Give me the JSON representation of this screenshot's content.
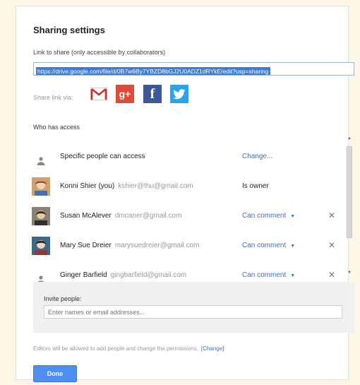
{
  "dialog": {
    "title": "Sharing settings",
    "link_label": "Link to share (only accessible by collaborators)",
    "link_url": "https://drive.google.com/file/d/0B7w6By7YBZD8bGJ2U0ADZ1dRYkE/edit?usp=sharing",
    "share_via_label": "Share link via:",
    "share_icons": [
      "gmail-icon",
      "google-plus-icon",
      "facebook-icon",
      "twitter-icon"
    ],
    "gplus_glyph": "g+",
    "fb_glyph": "f",
    "who_has_access_label": "Who has access"
  },
  "access": {
    "specific": {
      "label": "Specific people can access",
      "action": "Change..."
    },
    "people": [
      {
        "name": "Konni Shier (you)",
        "email": "kshier@thu@gmail.com",
        "permission": "Is owner"
      },
      {
        "name": "Susan McAlever",
        "email": "dmcaner@gmail.com",
        "permission": "Can comment",
        "caret": "▼",
        "remove": "✕"
      },
      {
        "name": "Mary Sue Dreier",
        "email": "marysuedreier@gmail.com",
        "permission": "Can comment",
        "caret": "▼",
        "remove": "✕"
      },
      {
        "name": "Ginger Barfield",
        "email": "gingbarfield@gmail.com",
        "permission": "Can comment",
        "caret": "▼",
        "remove": "✕"
      }
    ]
  },
  "scroll": {
    "up": "▲",
    "down": "▼"
  },
  "invite": {
    "label": "Invite people:",
    "placeholder": "Enter names or email addresses..."
  },
  "footer": {
    "note": "Editors will be allowed to add people and change the permissions.",
    "change_link": "[Change]",
    "done_label": "Done"
  },
  "colors": {
    "link_blue": "#3c6fc9",
    "done_button": "#4d8ef0",
    "page_background": "#fbf6e6"
  }
}
